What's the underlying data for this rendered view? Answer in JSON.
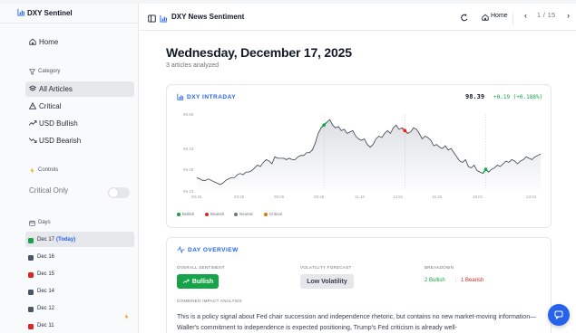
{
  "app": {
    "title": "DXY Sentinel"
  },
  "sidebar": {
    "home": "Home",
    "category_section": "Category",
    "categories": [
      {
        "label": "All Articles",
        "icon": "layers-icon",
        "active": true
      },
      {
        "label": "Critical",
        "icon": "warning-triangle-icon"
      },
      {
        "label": "USD Bullish",
        "icon": "trend-up-icon"
      },
      {
        "label": "USD Bearish",
        "icon": "trend-down-icon"
      }
    ],
    "controls_section": "Controls",
    "critical_only": {
      "label": "Critical Only",
      "on": false
    },
    "days_section": "Days",
    "days": [
      {
        "label": "Dec 17",
        "suffix": "(Today)",
        "color": "#16a34a",
        "active": true
      },
      {
        "label": "Dec 16",
        "color": "#4b5563"
      },
      {
        "label": "Dec 15",
        "color": "#dc2626"
      },
      {
        "label": "Dec 14",
        "color": "#4b5563"
      },
      {
        "label": "Dec 12",
        "color": "#4b5563"
      },
      {
        "label": "Dec 11",
        "color": "#dc2626",
        "flag_icon": "lightning-icon"
      }
    ]
  },
  "header": {
    "title": "DXY News Sentiment",
    "home": "Home",
    "pager": "1 / 15"
  },
  "main": {
    "date_title": "Wednesday, December 17, 2025",
    "articles_count": "3 articles analyzed"
  },
  "intraday": {
    "title": "DXY INTRADAY",
    "price": "98.39",
    "change": "+0.19 (+0.188%)"
  },
  "chart_data": {
    "type": "line",
    "title": "DXY INTRADAY",
    "x_ticks": [
      "00:45",
      "03:25",
      "06:05",
      "08:45",
      "11:18",
      "13:51",
      "16:25",
      "19:01",
      "23:04"
    ],
    "y_ticks": [
      "98.68",
      "98.43",
      "98.28",
      "98.13"
    ],
    "series": [
      {
        "values": [
          98.22,
          98.21,
          98.2,
          98.2,
          98.21,
          98.2,
          98.19,
          98.18,
          98.17,
          98.18,
          98.2,
          98.21,
          98.22,
          98.22,
          98.24,
          98.25,
          98.24,
          98.26,
          98.26,
          98.27,
          98.29,
          98.31,
          98.3,
          98.33,
          98.35,
          98.34,
          98.32,
          98.37,
          98.36,
          98.36,
          98.36,
          98.35,
          98.36,
          98.35,
          98.35,
          98.37,
          98.38,
          98.38,
          98.4,
          98.4,
          98.42,
          98.47,
          98.54,
          98.58,
          98.6,
          98.62,
          98.64,
          98.6,
          98.58,
          98.59,
          98.56,
          98.57,
          98.54,
          98.55,
          98.56,
          98.52,
          98.5,
          98.49,
          98.5,
          98.46,
          98.44,
          98.46,
          98.5,
          98.52,
          98.51,
          98.54,
          98.56,
          98.54,
          98.58,
          98.6,
          98.57,
          98.58,
          98.56,
          98.54,
          98.55,
          98.58,
          98.57,
          98.54,
          98.5,
          98.52,
          98.51,
          98.49,
          98.45,
          98.46,
          98.44,
          98.43,
          98.45,
          98.42,
          98.43,
          98.4,
          98.37,
          98.34,
          98.33,
          98.35,
          98.3,
          98.29,
          98.31,
          98.27,
          98.26,
          98.25,
          98.28,
          98.26,
          98.28,
          98.29,
          98.31,
          98.3,
          98.32,
          98.34,
          98.33,
          98.35,
          98.34,
          98.32,
          98.34,
          98.35,
          98.37,
          98.36,
          98.35,
          98.37,
          98.38,
          98.39
        ]
      }
    ],
    "events": [
      {
        "index": 44,
        "type": "Bullish"
      },
      {
        "index": 72,
        "type": "Bearish"
      },
      {
        "index": 100,
        "type": "Bullish"
      }
    ],
    "vlines_at_index": [
      44,
      72,
      100
    ],
    "legend": [
      "Bullish",
      "Bearish",
      "Neutral",
      "Critical"
    ],
    "legend_colors": [
      "#16a34a",
      "#dc2626",
      "#6b7280",
      "#d97706"
    ],
    "grid": false
  },
  "overview": {
    "title": "DAY OVERVIEW",
    "overall_sentiment_label": "OVERALL SENTIMENT",
    "overall_sentiment_value": "Bullish",
    "volatility_label": "VOLATILITY FORECAST",
    "volatility_value": "Low Volatility",
    "breakdown_label": "BREAKDOWN",
    "breakdown_bullish": "2 Bullish",
    "breakdown_bearish": "1 Bearish",
    "impact_label": "COMBINED IMPACT ANALYSIS",
    "impact_text": "This is a policy signal about Fed chair succession and independence rhetoric, but contains no new market-moving information—Waller's commitment to independence is expected positioning, Trump's Fed criticism is already well-"
  },
  "colors": {
    "accent": "#2563eb",
    "bullish": "#16a34a",
    "bearish": "#dc2626",
    "critical": "#d97706"
  }
}
